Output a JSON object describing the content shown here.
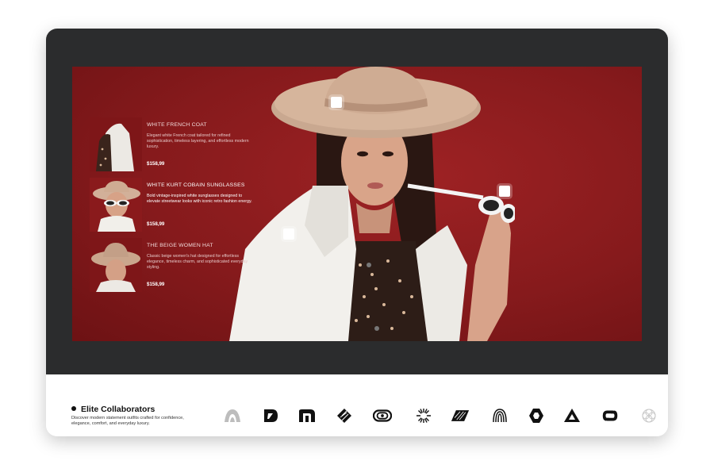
{
  "products": [
    {
      "title": "WHITE FRENCH COAT",
      "description": "Elegant white French coat tailored for refined sophistication, timeless layering, and effortless modern luxury.",
      "price": "$158,99"
    },
    {
      "title": "WHITE KURT COBAIN SUNGLASSES",
      "description": "Bold vintage-inspired white sunglasses designed to elevate streetwear looks with iconic retro fashion energy.",
      "price": "$158,99"
    },
    {
      "title": "THE BEIGE WOMEN HAT",
      "description": "Classic beige women's hat designed for effortless elegance, timeless charm, and sophisticated everyday styling.",
      "price": "$158,99"
    }
  ],
  "footer": {
    "title": "Elite Collaborators",
    "description": "Discover modern statement outfits crafted for confidence, elegance, comfort, and everyday luxury."
  },
  "logos": [
    "arc-logo-icon",
    "slash-d-logo-icon",
    "stripe-m-logo-icon",
    "diamond-logo-icon",
    "double-ring-logo-icon",
    "sunburst-logo-icon",
    "parallelogram-logo-icon",
    "fingerprint-logo-icon",
    "hexagon-logo-icon",
    "triangle-logo-icon",
    "loop-logo-icon",
    "flower-logo-icon"
  ],
  "colors": {
    "frame": "#2b2c2d",
    "stage": "#8b1a1c",
    "white": "#ffffff"
  }
}
